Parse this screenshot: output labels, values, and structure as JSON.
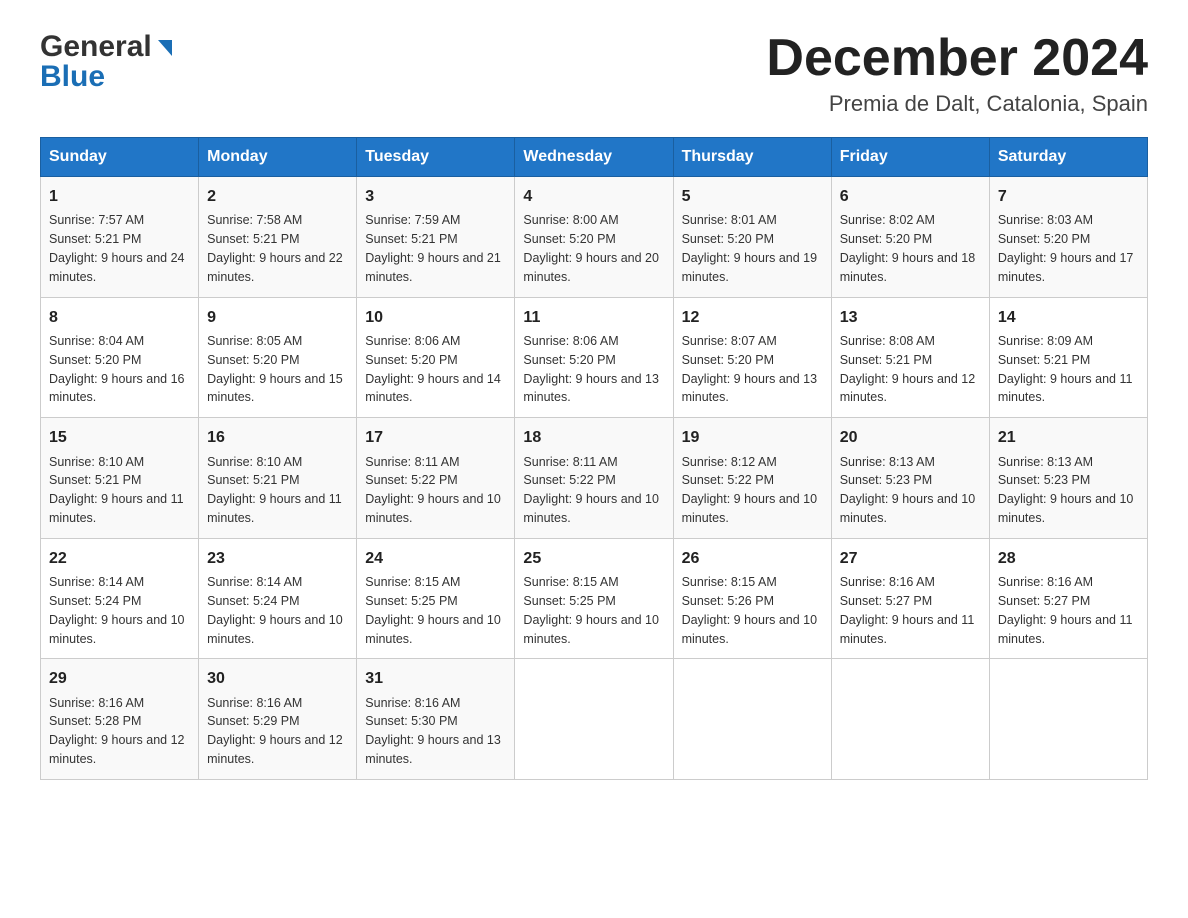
{
  "header": {
    "logo_general": "General",
    "logo_blue": "Blue",
    "title": "December 2024",
    "subtitle": "Premia de Dalt, Catalonia, Spain"
  },
  "weekdays": [
    "Sunday",
    "Monday",
    "Tuesday",
    "Wednesday",
    "Thursday",
    "Friday",
    "Saturday"
  ],
  "weeks": [
    [
      {
        "day": "1",
        "sunrise": "7:57 AM",
        "sunset": "5:21 PM",
        "daylight": "9 hours and 24 minutes."
      },
      {
        "day": "2",
        "sunrise": "7:58 AM",
        "sunset": "5:21 PM",
        "daylight": "9 hours and 22 minutes."
      },
      {
        "day": "3",
        "sunrise": "7:59 AM",
        "sunset": "5:21 PM",
        "daylight": "9 hours and 21 minutes."
      },
      {
        "day": "4",
        "sunrise": "8:00 AM",
        "sunset": "5:20 PM",
        "daylight": "9 hours and 20 minutes."
      },
      {
        "day": "5",
        "sunrise": "8:01 AM",
        "sunset": "5:20 PM",
        "daylight": "9 hours and 19 minutes."
      },
      {
        "day": "6",
        "sunrise": "8:02 AM",
        "sunset": "5:20 PM",
        "daylight": "9 hours and 18 minutes."
      },
      {
        "day": "7",
        "sunrise": "8:03 AM",
        "sunset": "5:20 PM",
        "daylight": "9 hours and 17 minutes."
      }
    ],
    [
      {
        "day": "8",
        "sunrise": "8:04 AM",
        "sunset": "5:20 PM",
        "daylight": "9 hours and 16 minutes."
      },
      {
        "day": "9",
        "sunrise": "8:05 AM",
        "sunset": "5:20 PM",
        "daylight": "9 hours and 15 minutes."
      },
      {
        "day": "10",
        "sunrise": "8:06 AM",
        "sunset": "5:20 PM",
        "daylight": "9 hours and 14 minutes."
      },
      {
        "day": "11",
        "sunrise": "8:06 AM",
        "sunset": "5:20 PM",
        "daylight": "9 hours and 13 minutes."
      },
      {
        "day": "12",
        "sunrise": "8:07 AM",
        "sunset": "5:20 PM",
        "daylight": "9 hours and 13 minutes."
      },
      {
        "day": "13",
        "sunrise": "8:08 AM",
        "sunset": "5:21 PM",
        "daylight": "9 hours and 12 minutes."
      },
      {
        "day": "14",
        "sunrise": "8:09 AM",
        "sunset": "5:21 PM",
        "daylight": "9 hours and 11 minutes."
      }
    ],
    [
      {
        "day": "15",
        "sunrise": "8:10 AM",
        "sunset": "5:21 PM",
        "daylight": "9 hours and 11 minutes."
      },
      {
        "day": "16",
        "sunrise": "8:10 AM",
        "sunset": "5:21 PM",
        "daylight": "9 hours and 11 minutes."
      },
      {
        "day": "17",
        "sunrise": "8:11 AM",
        "sunset": "5:22 PM",
        "daylight": "9 hours and 10 minutes."
      },
      {
        "day": "18",
        "sunrise": "8:11 AM",
        "sunset": "5:22 PM",
        "daylight": "9 hours and 10 minutes."
      },
      {
        "day": "19",
        "sunrise": "8:12 AM",
        "sunset": "5:22 PM",
        "daylight": "9 hours and 10 minutes."
      },
      {
        "day": "20",
        "sunrise": "8:13 AM",
        "sunset": "5:23 PM",
        "daylight": "9 hours and 10 minutes."
      },
      {
        "day": "21",
        "sunrise": "8:13 AM",
        "sunset": "5:23 PM",
        "daylight": "9 hours and 10 minutes."
      }
    ],
    [
      {
        "day": "22",
        "sunrise": "8:14 AM",
        "sunset": "5:24 PM",
        "daylight": "9 hours and 10 minutes."
      },
      {
        "day": "23",
        "sunrise": "8:14 AM",
        "sunset": "5:24 PM",
        "daylight": "9 hours and 10 minutes."
      },
      {
        "day": "24",
        "sunrise": "8:15 AM",
        "sunset": "5:25 PM",
        "daylight": "9 hours and 10 minutes."
      },
      {
        "day": "25",
        "sunrise": "8:15 AM",
        "sunset": "5:25 PM",
        "daylight": "9 hours and 10 minutes."
      },
      {
        "day": "26",
        "sunrise": "8:15 AM",
        "sunset": "5:26 PM",
        "daylight": "9 hours and 10 minutes."
      },
      {
        "day": "27",
        "sunrise": "8:16 AM",
        "sunset": "5:27 PM",
        "daylight": "9 hours and 11 minutes."
      },
      {
        "day": "28",
        "sunrise": "8:16 AM",
        "sunset": "5:27 PM",
        "daylight": "9 hours and 11 minutes."
      }
    ],
    [
      {
        "day": "29",
        "sunrise": "8:16 AM",
        "sunset": "5:28 PM",
        "daylight": "9 hours and 12 minutes."
      },
      {
        "day": "30",
        "sunrise": "8:16 AM",
        "sunset": "5:29 PM",
        "daylight": "9 hours and 12 minutes."
      },
      {
        "day": "31",
        "sunrise": "8:16 AM",
        "sunset": "5:30 PM",
        "daylight": "9 hours and 13 minutes."
      },
      null,
      null,
      null,
      null
    ]
  ],
  "labels": {
    "sunrise_prefix": "Sunrise: ",
    "sunset_prefix": "Sunset: ",
    "daylight_prefix": "Daylight: "
  }
}
